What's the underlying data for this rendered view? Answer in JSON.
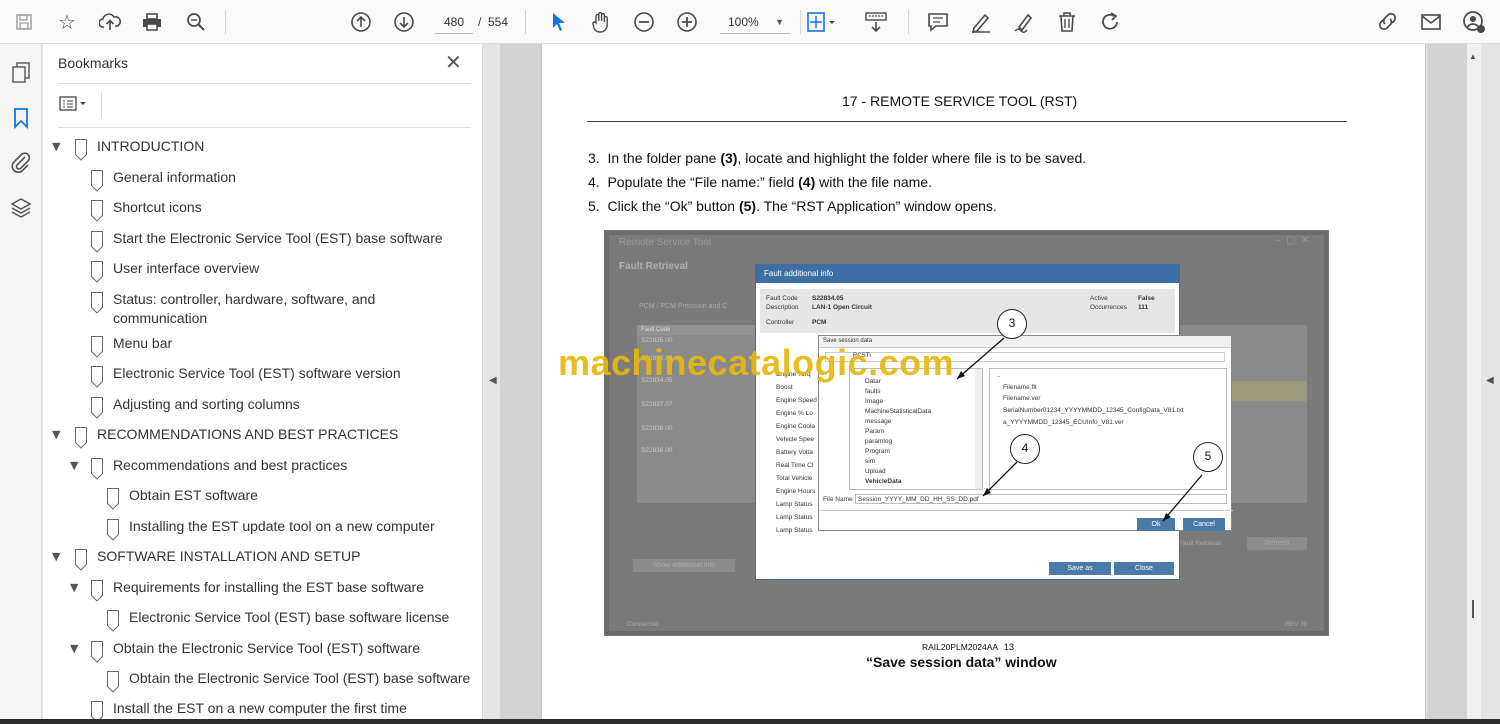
{
  "toolbar": {
    "page_current": "480",
    "page_sep": "/",
    "page_total": "554",
    "zoom": "100%",
    "icons": [
      "save-icon",
      "star-icon",
      "upload-icon",
      "print-icon",
      "zoom-search-icon",
      "page-up-icon",
      "page-down-icon",
      "select-cursor-icon",
      "hand-icon",
      "zoom-out-icon",
      "zoom-in-icon",
      "fit-page-icon",
      "scroll-mode-icon",
      "comment-icon",
      "pen-icon",
      "sign-icon",
      "delete-icon",
      "redo-icon",
      "share-link-icon",
      "email-icon",
      "account-icon"
    ]
  },
  "bookmarks_panel": {
    "title": "Bookmarks",
    "items": [
      {
        "label": "INTRODUCTION",
        "level": 0,
        "expanded": true
      },
      {
        "label": "General information",
        "level": 1
      },
      {
        "label": "Shortcut icons",
        "level": 1
      },
      {
        "label": "Start the Electronic Service Tool (EST) base software",
        "level": 1
      },
      {
        "label": "User interface overview",
        "level": 1
      },
      {
        "label": "Status: controller, hardware, software, and",
        "label2": "communication",
        "level": 1
      },
      {
        "label": "Menu bar",
        "level": 1
      },
      {
        "label": "Electronic Service Tool (EST) software version",
        "level": 1
      },
      {
        "label": "Adjusting and sorting columns",
        "level": 1
      },
      {
        "label": "RECOMMENDATIONS AND BEST PRACTICES",
        "level": 0,
        "expanded": true
      },
      {
        "label": "Recommendations and best practices",
        "level": 1,
        "expanded": true
      },
      {
        "label": "Obtain EST software",
        "level": 2
      },
      {
        "label": "Installing the EST update tool on a new computer",
        "level": 2
      },
      {
        "label": "SOFTWARE INSTALLATION AND SETUP",
        "level": 0,
        "expanded": true
      },
      {
        "label": "Requirements for installing the EST base software",
        "level": 1,
        "expanded": true
      },
      {
        "label": "Electronic Service Tool (EST) base software license",
        "level": 2
      },
      {
        "label": "Obtain the Electronic Service Tool (EST) software",
        "level": 1,
        "expanded": true
      },
      {
        "label": "Obtain the Electronic Service Tool (EST) base software",
        "level": 2
      },
      {
        "label": "Install the EST on a new computer the first time",
        "level": 1
      }
    ]
  },
  "document": {
    "chapter_header": "17 - REMOTE SERVICE TOOL (RST)",
    "steps": [
      {
        "num": "3.",
        "pre": "In the folder pane ",
        "bold": "(3)",
        "post": ", locate and highlight the folder where file is to be saved."
      },
      {
        "num": "4.",
        "pre": "Populate the “File name:” field ",
        "bold": "(4)",
        "post": " with the file name."
      },
      {
        "num": "5.",
        "pre": "Click the “Ok” button ",
        "bold": "(5)",
        "post": ".  The “RST Application” window opens."
      }
    ],
    "figure": {
      "window_title": "Remote Service Tool",
      "screen_title": "Fault Retrieval",
      "breadcrumb": "PCM  /  PCM  Precision and C",
      "col_header": "Fault Code",
      "fault_codes": [
        "S22835.00",
        "S22835.05",
        "S22834.05",
        "S22837.07",
        "S22838.00",
        "S22838.00"
      ],
      "fault_dialog": {
        "title": "Fault additional info",
        "fault_code_label": "Fault Code",
        "fault_code": "S22834.05",
        "description_label": "Description",
        "description": "LAN-1 Open Circuit",
        "controller_label": "Controller",
        "controller": "PCM",
        "active_label": "Active",
        "active": "False",
        "occurrences_label": "Occurrences",
        "occurrences": "111",
        "params": [
          "Engine Torq",
          "Boost",
          "Engine Speed",
          "Engine % Lo",
          "Engine Coola",
          "Vehicle Spee",
          "Battery Volta",
          "Real Time Cl",
          "Total Vehicle",
          "Engine Hours",
          "Lamp Status",
          "Lamp Status",
          "Lamp Status"
        ],
        "save_as": "Save as",
        "close": "Close"
      },
      "save_dialog": {
        "title": "Save session data",
        "path": "RCST\\",
        "folders": [
          "Datar",
          "faults",
          "Image",
          "MachineStatisticalData",
          "message",
          "Param",
          "paramlog",
          "Program",
          "sim",
          "Upload",
          "VehicleData"
        ],
        "files": [
          "..",
          "Filename.flt",
          "Filename.ver",
          "SerialNumber01234_YYYYMMDD_12345_ConfigData_V81.txt",
          "a_YYYYMMDD_12345_ECUInfo_V81.ver"
        ],
        "file_name_label": "File Name",
        "file_name": "Session_YYYY_MM_DD_HH_SS_DD.pdf",
        "ok": "Ok",
        "cancel": "Cancel"
      },
      "bottom_left_btn": "Show additional info",
      "bottom_right_label": "Fault Retrieval",
      "bottom_right_btn": "Refresh",
      "status_left": "Connected",
      "status_right": "REV 30",
      "callouts": [
        "3",
        "4",
        "5"
      ]
    },
    "watermark": "machinecatalogic.com",
    "figure_code": "RAIL20PLM2024AA",
    "figure_num": "13",
    "caption": "“Save session data” window"
  }
}
